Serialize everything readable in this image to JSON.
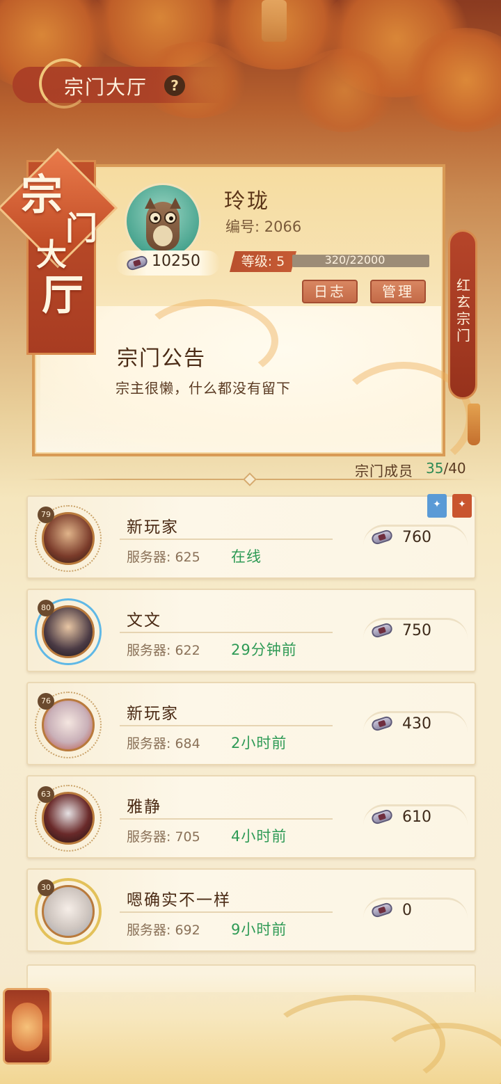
{
  "header": {
    "title": "宗门大厅",
    "help_label": "?"
  },
  "banner": {
    "chars": [
      "宗",
      "门",
      "大",
      "厅"
    ]
  },
  "guild": {
    "name": "玲珑",
    "id_text": "编号: 2066",
    "funds": "10250",
    "level_text": "等级: 5",
    "xp_text": "320/22000",
    "xp_fraction": 0.0145,
    "log_button": "日志",
    "manage_button": "管理",
    "side_banner": [
      "红",
      "玄",
      "宗",
      "门"
    ],
    "avatar_icon": "owl-icon"
  },
  "notice": {
    "title": "宗门公告",
    "text": "宗主很懒，什么都没有留下"
  },
  "members": {
    "label": "宗门成员",
    "online": "35",
    "total": "/40",
    "rows": [
      {
        "level": "79",
        "name": "新玩家",
        "server": "服务器: 625",
        "status": "在线",
        "points": "760"
      },
      {
        "level": "80",
        "name": "文文",
        "server": "服务器: 622",
        "status": "29分钟前",
        "points": "750"
      },
      {
        "level": "76",
        "name": "新玩家",
        "server": "服务器: 684",
        "status": "2小时前",
        "points": "430"
      },
      {
        "level": "63",
        "name": "雅静",
        "server": "服务器: 705",
        "status": "4小时前",
        "points": "610"
      },
      {
        "level": "30",
        "name": "嗯确实不一样",
        "server": "服务器: 692",
        "status": "9小时前",
        "points": "0"
      }
    ]
  },
  "colors": {
    "accent_red": "#b9502e",
    "status_green": "#2e9a55",
    "gold": "#d89a55"
  }
}
